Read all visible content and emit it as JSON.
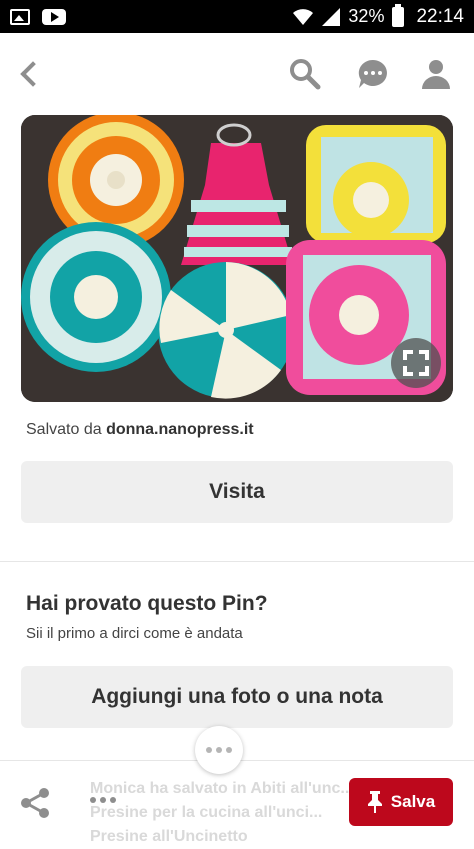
{
  "status_bar": {
    "battery": "32%",
    "time": "22:14",
    "icons": [
      "image-icon",
      "youtube-icon",
      "wifi-icon",
      "signal-icon",
      "battery-icon"
    ]
  },
  "top_bar": {
    "icons": [
      "back-icon",
      "search-icon",
      "comment-icon",
      "profile-icon"
    ],
    "icon_color": "#8e8e8e"
  },
  "pin": {
    "image_description_icon": "crochet-potholders-image",
    "expand_icon": "expand-icon",
    "saved_prefix": "Salvato da",
    "saved_source": "donna.nanopress.it",
    "visit_label": "Visita"
  },
  "tried": {
    "title": "Hai provato questo Pin?",
    "subtitle": "Sii il primo a dirci come è andata",
    "add_label": "Aggiungi una foto o una nota"
  },
  "bottom_bar": {
    "faded_lines": [
      "Monica ha salvato in Abiti all'unc...",
      "Presine per la cucina all'unci...",
      "Presine all'Uncinetto"
    ],
    "save_label": "Salva",
    "accent": "#bd081c"
  }
}
